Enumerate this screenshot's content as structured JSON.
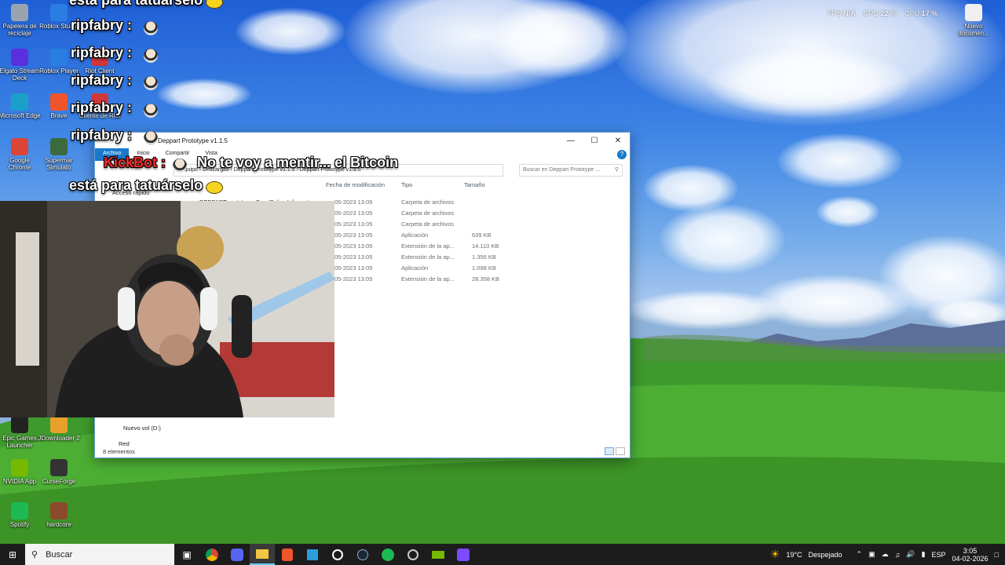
{
  "desktop": {
    "icons": [
      {
        "label": "Papelera de reciclaje",
        "icon": "recycle-bin-icon",
        "color": "#9aa4b0"
      },
      {
        "label": "Roblox Studio",
        "icon": "roblox-studio-icon",
        "color": "#2a7de1"
      },
      {
        "label": "Elgato Stream Deck",
        "icon": "stream-deck-icon",
        "color": "#5b2ee0"
      },
      {
        "label": "Roblox Player",
        "icon": "roblox-player-icon",
        "color": "#2a7de1"
      },
      {
        "label": "Riot Client",
        "icon": "riot-icon",
        "color": "#d13639"
      },
      {
        "label": "Microsoft Edge",
        "icon": "edge-icon",
        "color": "#1ba0c9"
      },
      {
        "label": "Brave",
        "icon": "brave-icon",
        "color": "#f0542d"
      },
      {
        "label": "Cliente de Riot",
        "icon": "riot-client-icon",
        "color": "#d13639"
      },
      {
        "label": "Google Chrome",
        "icon": "chrome-icon",
        "color": "#db4437"
      },
      {
        "label": "Supermar Simulato",
        "icon": "game-icon",
        "color": "#3b6a3f"
      },
      {
        "label": "Epic Games Launcher",
        "icon": "epic-games-icon",
        "color": "#222222"
      },
      {
        "label": "JDownloader 2",
        "icon": "jdownloader-icon",
        "color": "#e8a02a"
      },
      {
        "label": "NVIDIA App",
        "icon": "nvidia-icon",
        "color": "#76b900"
      },
      {
        "label": "CurseForge",
        "icon": "curseforge-icon",
        "color": "#333333"
      },
      {
        "label": "Spotify",
        "icon": "spotify-icon",
        "color": "#1db954"
      },
      {
        "label": "hardcore",
        "icon": "hardcore-icon",
        "color": "#8b4a2b"
      },
      {
        "label": "Nuevo documen...",
        "icon": "new-document-icon",
        "color": "#f0f0f0"
      }
    ]
  },
  "overlay": {
    "fps_label": "FPS",
    "fps_value": "N/A",
    "gpu_label": "GPU",
    "gpu_value": "22 %",
    "cpu_label": "CPU",
    "cpu_value": "17 %"
  },
  "chat": {
    "lines": [
      {
        "user": "está para tatuárselo",
        "text": ""
      },
      {
        "user": "ripfabry :",
        "text": ""
      },
      {
        "user": "ripfabry :",
        "text": ""
      },
      {
        "user": "ripfabry :",
        "text": ""
      },
      {
        "user": "ripfabry :",
        "text": ""
      },
      {
        "user": "ripfabry :",
        "text": ""
      },
      {
        "user": "KickBot :",
        "text": "No te voy a mentir... el Bitcoin"
      },
      {
        "user": "está para tatuárselo",
        "text": ""
      }
    ]
  },
  "explorer": {
    "title": "Deppart Prototype v1.1.5",
    "ribbon": [
      "Archivo",
      "Inicio",
      "Compartir",
      "Vista"
    ],
    "address": [
      "Equipo",
      "Descargas",
      "Deppart Prototype v1.1.5",
      "Deppart Prototype v1.1.5"
    ],
    "search_placeholder": "Buscar en Deppart Prototype ...",
    "nav": {
      "quick_access": "Acceso rápido",
      "drive": "Nuevo vol (D:)",
      "network": "Red"
    },
    "columns": {
      "modified": "Fecha de modificación",
      "type": "Tipo",
      "size": "Tamaño"
    },
    "first_file": "DEPPART prototype_BurstDebugInformat",
    "rows": [
      {
        "date": "05-2023 13:05",
        "type": "Carpeta de archivos",
        "size": ""
      },
      {
        "date": "05-2023 13:05",
        "type": "Carpeta de archivos",
        "size": ""
      },
      {
        "date": "05-2023 13:05",
        "type": "Carpeta de archivos",
        "size": ""
      },
      {
        "date": "05-2023 13:05",
        "type": "Aplicación",
        "size": "639 KB"
      },
      {
        "date": "05-2023 13:05",
        "type": "Extensión de la ap...",
        "size": "14.110 KB"
      },
      {
        "date": "05-2023 13:05",
        "type": "Extensión de la ap...",
        "size": "1.356 KB"
      },
      {
        "date": "05-2023 13:05",
        "type": "Aplicación",
        "size": "1.098 KB"
      },
      {
        "date": "05-2023 13:05",
        "type": "Extensión de la ap...",
        "size": "28.358 KB"
      }
    ],
    "status": "8 elementos"
  },
  "taskbar": {
    "search_label": "Buscar",
    "weather_temp": "19°C",
    "weather_text": "Despejado",
    "lang": "ESP",
    "time": "3:05",
    "date": "04-02-2026"
  }
}
